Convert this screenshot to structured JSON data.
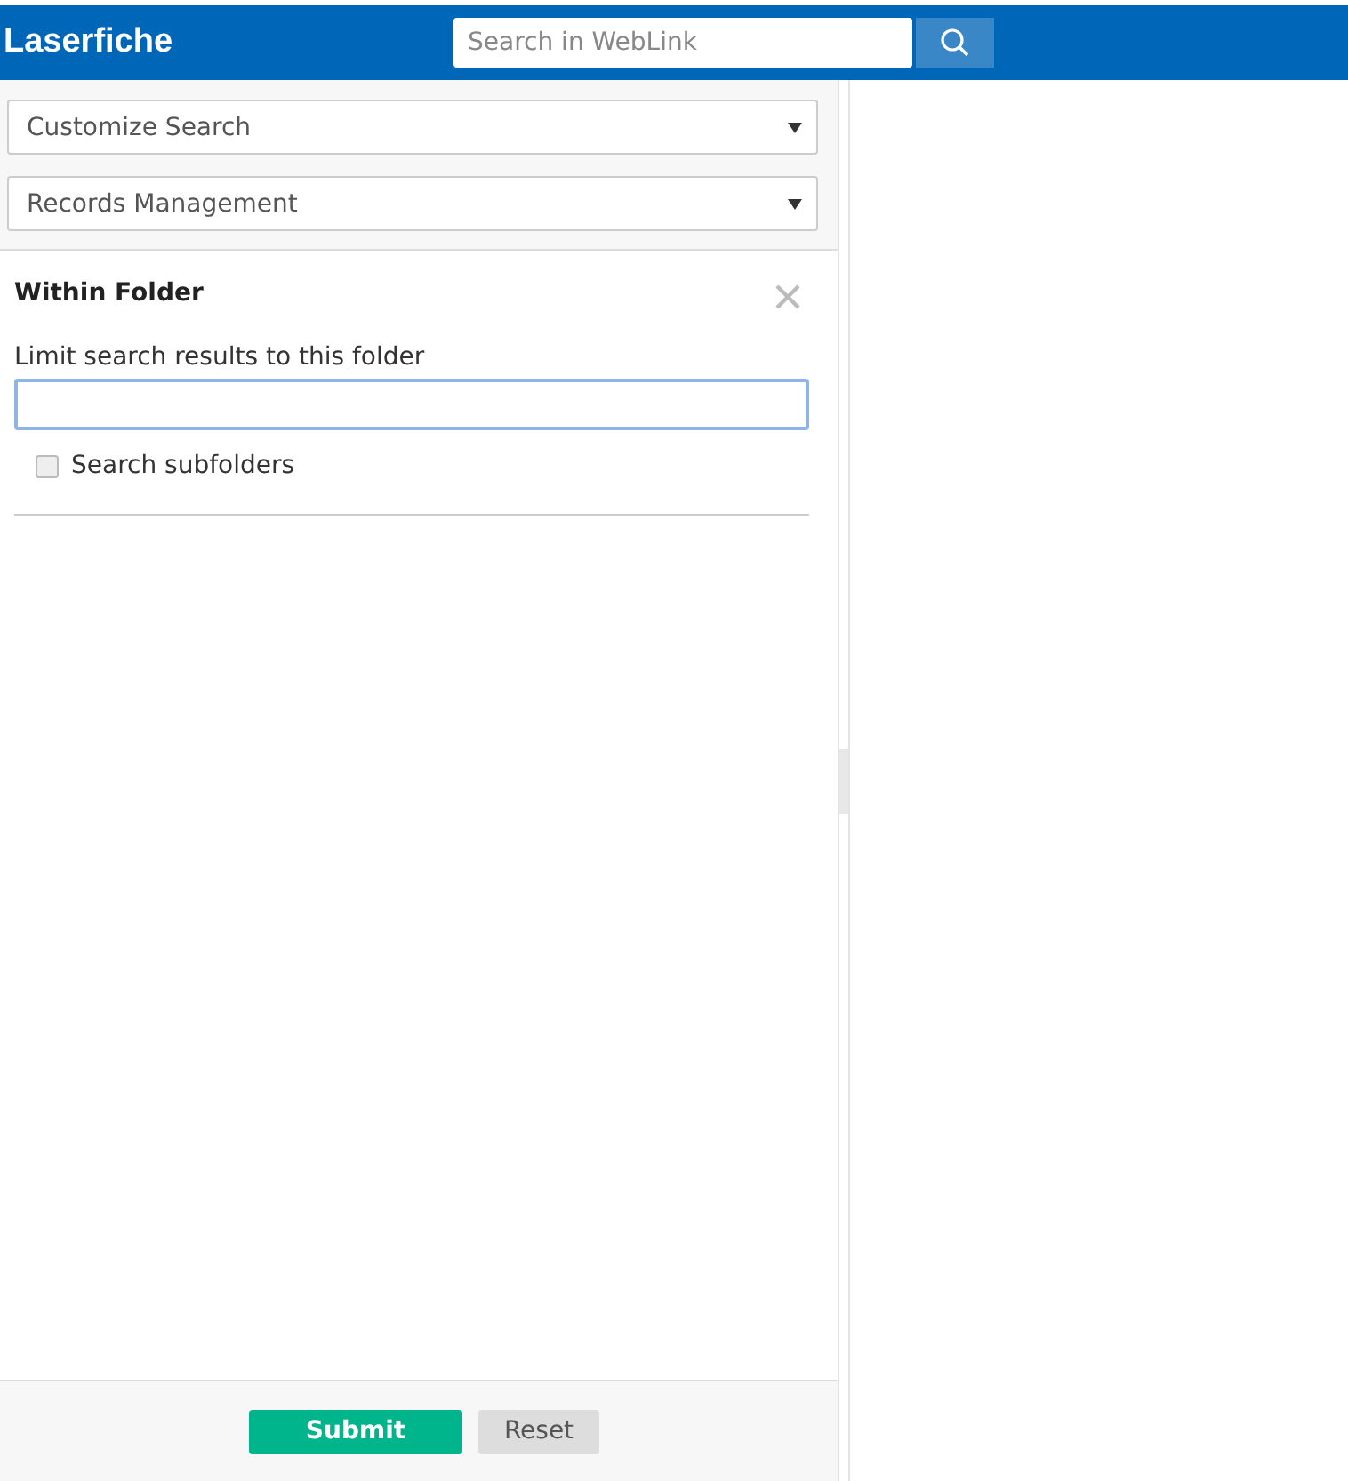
{
  "header": {
    "logo": "Laserfiche",
    "search": {
      "placeholder": "Search in WebLink"
    }
  },
  "dropdowns": [
    {
      "value": "Customize Search"
    },
    {
      "value": "Records Management"
    }
  ],
  "panel": {
    "title": "Within Folder",
    "field_label": "Limit search results to this folder",
    "field": {
      "focused": true
    },
    "checkbox": {
      "label": "Search subfolders",
      "checked": false
    }
  },
  "buttons": [
    {
      "label": "Submit",
      "kind": "primary"
    },
    {
      "label": "Reset",
      "kind": "secondary"
    }
  ]
}
